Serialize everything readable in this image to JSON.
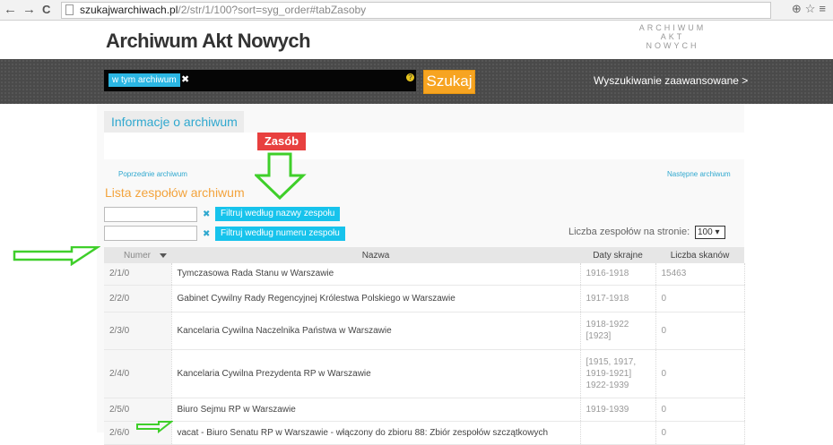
{
  "browser": {
    "back_glyph": "←",
    "forward_glyph": "→",
    "reload_glyph": "C",
    "url_host": "szukajwarchiwach.pl",
    "url_path": "/2/str/1/100?sort=syg_order#tabZasoby",
    "right_glyphs": "⊕☆≡"
  },
  "header": {
    "site_title": "Archiwum Akt Nowych",
    "logo_line1": "ARCHIWUM",
    "logo_line2": "AKT NOWYCH"
  },
  "search": {
    "scope_tag": "w tym archiwum",
    "scope_remove_glyph": "✖",
    "help_glyph": "?",
    "button_label": "Szukaj",
    "advanced_link": "Wyszukiwanie zaawansowane >"
  },
  "archive": {
    "info_tab": "Informacje o archiwum",
    "prev_link": "Poprzednie archiwum",
    "next_link": "Następne archiwum",
    "list_title": "Lista zespołów archiwum"
  },
  "filters": {
    "name_filter_button": "Filtruj według  nazwy  zespołu",
    "number_filter_button": "Filtruj według numeru zespołu",
    "clear_glyph": "✖",
    "per_page_label": "Liczba zespołów na stronie:",
    "per_page_value": "100 ▾"
  },
  "annotation": {
    "zasob_label": "Zasób",
    "arrow_color": "#3fcf2a",
    "label_color": "#e8403f"
  },
  "table": {
    "headers": {
      "number": "Numer",
      "name": "Nazwa",
      "dates": "Daty skrajne",
      "scans": "Liczba skanów"
    },
    "rows": [
      {
        "number": "2/1/0",
        "name": "Tymczasowa Rada Stanu w Warszawie",
        "dates": "1916-1918",
        "scans": "15463"
      },
      {
        "number": "2/2/0",
        "name": "Gabinet Cywilny Rady Regencyjnej Królestwa Polskiego w Warszawie",
        "dates": "1917-1918",
        "scans": "0"
      },
      {
        "number": "2/3/0",
        "name": "Kancelaria Cywilna Naczelnika Państwa w Warszawie",
        "dates": "1918-1922\n[1923]",
        "scans": "0"
      },
      {
        "number": "2/4/0",
        "name": "Kancelaria Cywilna Prezydenta RP w Warszawie",
        "dates": "[1915, 1917,\n1919-1921]\n1922-1939",
        "scans": "0"
      },
      {
        "number": "2/5/0",
        "name": "Biuro Sejmu RP w Warszawie",
        "dates": "1919-1939",
        "scans": "0"
      },
      {
        "number": "2/6/0",
        "name": "vacat - Biuro Senatu RP w Warszawie - włączony do zbioru 88: Zbiór zespołów szczątkowych",
        "dates": "",
        "scans": "0"
      }
    ]
  }
}
